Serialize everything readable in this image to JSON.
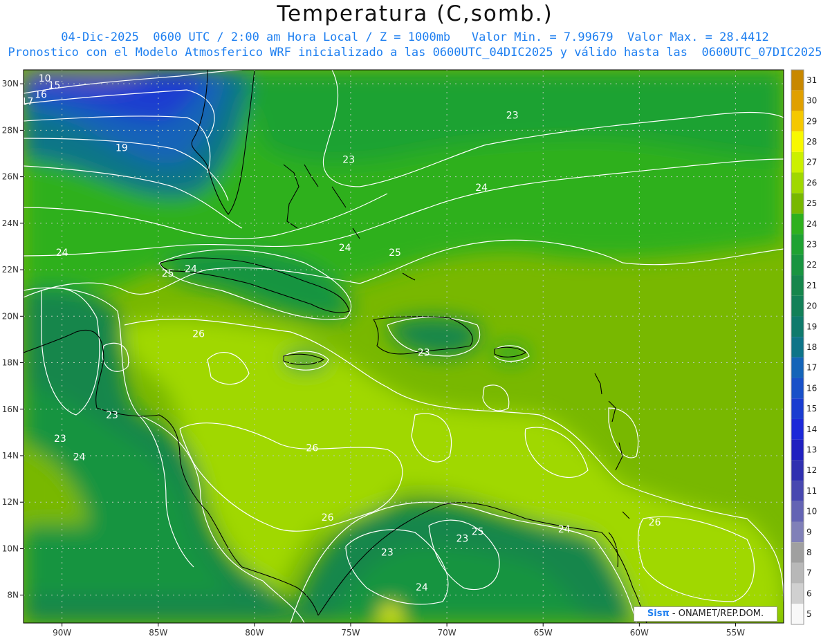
{
  "header": {
    "title": "Temperatura (C,somb.)",
    "subtitle_line1": "04-Dic-2025  0600 UTC / 2:00 am Hora Local / Z = 1000mb   Valor Min. = 7.99679  Valor Max. = 28.4412",
    "subtitle_line2": "Pronostico con el Modelo Atmosferico WRF inicializado a las 0600UTC_04DIC2025 y válido hasta las  0600UTC_07DIC2025"
  },
  "axes": {
    "longitude_labels": [
      "90W",
      "85W",
      "80W",
      "75W",
      "70W",
      "65W",
      "60W",
      "55W"
    ],
    "latitude_labels": [
      "30N",
      "28N",
      "26N",
      "24N",
      "22N",
      "20N",
      "18N",
      "16N",
      "14N",
      "12N",
      "10N",
      "8N"
    ],
    "lon_range": [
      -92,
      -52.5
    ],
    "lat_range": [
      6.8,
      30.6
    ]
  },
  "colorbar": {
    "levels": [
      "31",
      "30",
      "29",
      "28",
      "27",
      "26",
      "25",
      "24",
      "23",
      "22",
      "21",
      "20",
      "19",
      "18",
      "17",
      "16",
      "15",
      "14",
      "13",
      "12",
      "11",
      "10",
      "9",
      "8",
      "7",
      "6",
      "5"
    ],
    "colors": [
      "#c88800",
      "#e0a000",
      "#f5c800",
      "#f8f800",
      "#ccf000",
      "#a0d800",
      "#78b800",
      "#2eb01e",
      "#1fa232",
      "#199440",
      "#16864c",
      "#138058",
      "#0f7a6c",
      "#0e7488",
      "#1464b8",
      "#1850c8",
      "#1a3cd0",
      "#1c28d8",
      "#2020c0",
      "#3030b0",
      "#4848b0",
      "#6464b4",
      "#8080b8",
      "#a0a0a0",
      "#b8b8b8",
      "#d0d0d0",
      "#f8f8f8"
    ]
  },
  "contour_labels": [
    {
      "text": "10",
      "lon": -90.9,
      "lat": 30.1
    },
    {
      "text": "15",
      "lon": -90.4,
      "lat": 29.8
    },
    {
      "text": "16",
      "lon": -91.1,
      "lat": 29.4
    },
    {
      "text": "17",
      "lon": -91.8,
      "lat": 29.1
    },
    {
      "text": "19",
      "lon": -86.9,
      "lat": 27.1
    },
    {
      "text": "23",
      "lon": -75.1,
      "lat": 26.6
    },
    {
      "text": "23",
      "lon": -66.6,
      "lat": 28.5
    },
    {
      "text": "24",
      "lon": -68.2,
      "lat": 25.4
    },
    {
      "text": "24",
      "lon": -90.0,
      "lat": 22.6
    },
    {
      "text": "24",
      "lon": -75.3,
      "lat": 22.8
    },
    {
      "text": "25",
      "lon": -84.5,
      "lat": 21.7
    },
    {
      "text": "24",
      "lon": -83.3,
      "lat": 21.9
    },
    {
      "text": "25",
      "lon": -72.7,
      "lat": 22.6
    },
    {
      "text": "26",
      "lon": -82.9,
      "lat": 19.1
    },
    {
      "text": "23",
      "lon": -71.2,
      "lat": 18.3
    },
    {
      "text": "23",
      "lon": -87.4,
      "lat": 15.6
    },
    {
      "text": "23",
      "lon": -90.1,
      "lat": 14.6
    },
    {
      "text": "24",
      "lon": -89.1,
      "lat": 13.8
    },
    {
      "text": "26",
      "lon": -77.0,
      "lat": 14.2
    },
    {
      "text": "26",
      "lon": -76.2,
      "lat": 11.2
    },
    {
      "text": "26",
      "lon": -59.2,
      "lat": 11.0
    },
    {
      "text": "25",
      "lon": -68.4,
      "lat": 10.6
    },
    {
      "text": "24",
      "lon": -63.9,
      "lat": 10.7
    },
    {
      "text": "23",
      "lon": -69.2,
      "lat": 10.3
    },
    {
      "text": "23",
      "lon": -73.1,
      "lat": 9.7
    },
    {
      "text": "24",
      "lon": -71.3,
      "lat": 8.2
    }
  ],
  "footer": {
    "credit_brand": "Sisπ",
    "credit_text": " - ONAMET/REP.DOM."
  }
}
